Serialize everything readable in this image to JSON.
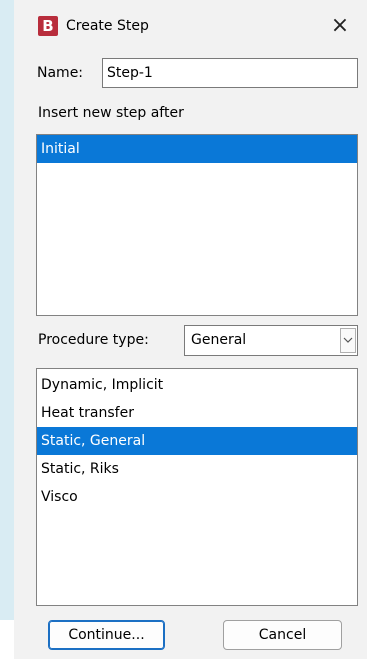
{
  "window": {
    "title": "Create Step",
    "logo_glyph": "B",
    "close_glyph": "×",
    "accent_color": "#0a78d7",
    "logo_color": "#b82d3c"
  },
  "name": {
    "label": "Name:",
    "value": "Step-1"
  },
  "insert_after": {
    "label": "Insert new step after",
    "items": [
      {
        "label": "Initial",
        "selected": true
      }
    ]
  },
  "procedure": {
    "label": "Procedure type:",
    "selected": "General",
    "items": [
      {
        "label": "Dynamic, Implicit",
        "selected": false
      },
      {
        "label": "Heat transfer",
        "selected": false
      },
      {
        "label": "Static, General",
        "selected": true
      },
      {
        "label": "Static, Riks",
        "selected": false
      },
      {
        "label": "Visco",
        "selected": false
      }
    ]
  },
  "buttons": {
    "continue_label": "Continue...",
    "cancel_label": "Cancel"
  }
}
